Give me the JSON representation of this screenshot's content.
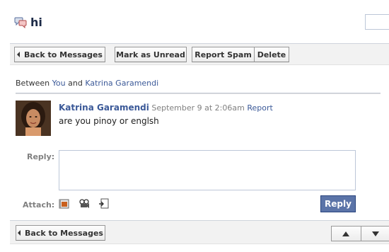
{
  "thread": {
    "title": "hi",
    "icon": "speech-bubbles-icon"
  },
  "toolbar": {
    "back_label": "Back to Messages",
    "mark_unread_label": "Mark as Unread",
    "report_spam_label": "Report Spam",
    "delete_label": "Delete"
  },
  "participants": {
    "prefix": "Between",
    "you": "You",
    "conjunction": "and",
    "other": "Katrina Garamendi"
  },
  "message": {
    "author": "Katrina Garamendi",
    "timestamp": "September 9 at 2:06am",
    "report_label": "Report",
    "body": "are you pinoy or englsh"
  },
  "reply": {
    "label": "Reply:",
    "value": "",
    "button_label": "Reply"
  },
  "attach": {
    "label": "Attach:",
    "icons": [
      "photo-icon",
      "video-icon",
      "link-icon"
    ]
  },
  "bottom_bar": {
    "back_label": "Back to Messages",
    "prev_icon": "up-arrow-icon",
    "next_icon": "down-arrow-icon"
  },
  "colors": {
    "link": "#3b5998",
    "reply_button": "#5b74a8",
    "toolbar_bg": "#f2f2f2"
  }
}
